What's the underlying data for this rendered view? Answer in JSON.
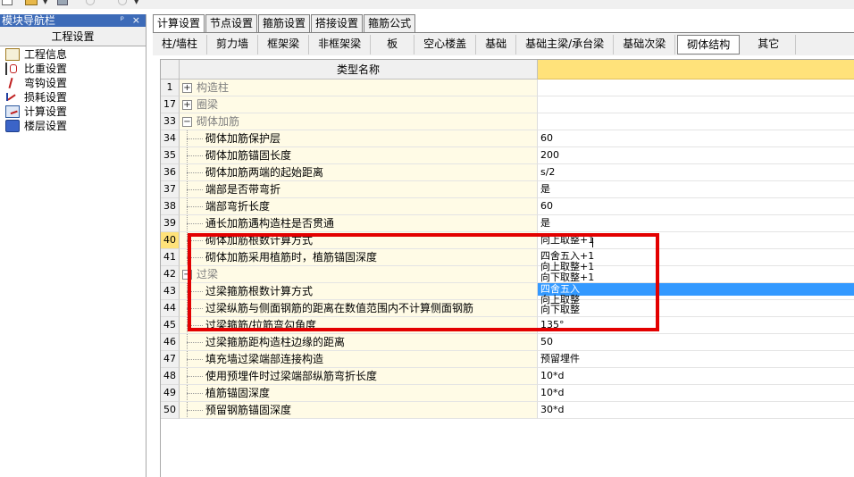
{
  "nav": {
    "title": "模块导航栏",
    "pin": "ᵖ",
    "close": "×",
    "group": "工程设置",
    "items": [
      {
        "label": "工程信息",
        "icon": "project-info-icon"
      },
      {
        "label": "比重设置",
        "icon": "weight-ratio-icon"
      },
      {
        "label": "弯钩设置",
        "icon": "hook-icon"
      },
      {
        "label": "损耗设置",
        "icon": "loss-icon"
      },
      {
        "label": "计算设置",
        "icon": "calc-settings-icon"
      },
      {
        "label": "楼层设置",
        "icon": "floor-settings-icon"
      }
    ]
  },
  "tabs": [
    "计算设置",
    "节点设置",
    "箍筋设置",
    "搭接设置",
    "箍筋公式"
  ],
  "subtabs": [
    "柱/墙柱",
    "剪力墙",
    "框架梁",
    "非框架梁",
    "板",
    "空心楼盖",
    "基础",
    "基础主梁/承台梁",
    "基础次梁",
    "砌体结构",
    "其它"
  ],
  "grid": {
    "header_name": "类型名称",
    "rows": [
      {
        "num": "1",
        "type": "group",
        "expand": "+",
        "name": "构造柱",
        "value": ""
      },
      {
        "num": "17",
        "type": "group",
        "expand": "+",
        "name": "圈梁",
        "value": ""
      },
      {
        "num": "33",
        "type": "group",
        "expand": "−",
        "name": "砌体加筋",
        "value": ""
      },
      {
        "num": "34",
        "type": "leaf",
        "name": "砌体加筋保护层",
        "value": "60"
      },
      {
        "num": "35",
        "type": "leaf",
        "name": "砌体加筋锚固长度",
        "value": "200"
      },
      {
        "num": "36",
        "type": "leaf",
        "name": "砌体加筋两端的起始距离",
        "value": "s/2"
      },
      {
        "num": "37",
        "type": "leaf",
        "name": "端部是否带弯折",
        "value": "是"
      },
      {
        "num": "38",
        "type": "leaf",
        "name": "端部弯折长度",
        "value": "60"
      },
      {
        "num": "39",
        "type": "leaf",
        "name": "通长加筋遇构造柱是否贯通",
        "value": "是"
      },
      {
        "num": "40",
        "type": "leaf",
        "current": true,
        "name": "砌体加筋根数计算方式",
        "value": "向上取整+1"
      },
      {
        "num": "41",
        "type": "leaf",
        "name": "砌体加筋采用植筋时，植筋锚固深度",
        "value": ""
      },
      {
        "num": "42",
        "type": "group",
        "expand": "−",
        "name": "过梁",
        "value": ""
      },
      {
        "num": "43",
        "type": "leaf",
        "name": "过梁箍筋根数计算方式",
        "value": ""
      },
      {
        "num": "44",
        "type": "leaf",
        "name": "过梁纵筋与侧面钢筋的距离在数值范围内不计算侧面钢筋",
        "value": ""
      },
      {
        "num": "45",
        "type": "leaf",
        "name": "过梁箍筋/拉筋弯勾角度",
        "value": "135°"
      },
      {
        "num": "46",
        "type": "leaf",
        "name": "过梁箍筋距构造柱边缘的距离",
        "value": "50"
      },
      {
        "num": "47",
        "type": "leaf",
        "name": "填充墙过梁端部连接构造",
        "value": "预留埋件"
      },
      {
        "num": "48",
        "type": "leaf",
        "name": "使用预埋件时过梁端部纵筋弯折长度",
        "value": "10*d"
      },
      {
        "num": "49",
        "type": "leaf",
        "name": "植筋锚固深度",
        "value": "10*d"
      },
      {
        "num": "50",
        "type": "leaf",
        "name": "预留钢筋锚固深度",
        "value": "30*d"
      }
    ]
  },
  "dropdown": {
    "items": [
      "四舍五入+1",
      "向上取整+1",
      "向下取整+1",
      "四舍五入",
      "向上取整",
      "向下取整"
    ],
    "selected_index": 3
  },
  "colors": {
    "nav_header": "#3d6bb8",
    "value_header": "#ffe27a",
    "selection": "#3399ff",
    "highlight_box": "#e30000"
  }
}
